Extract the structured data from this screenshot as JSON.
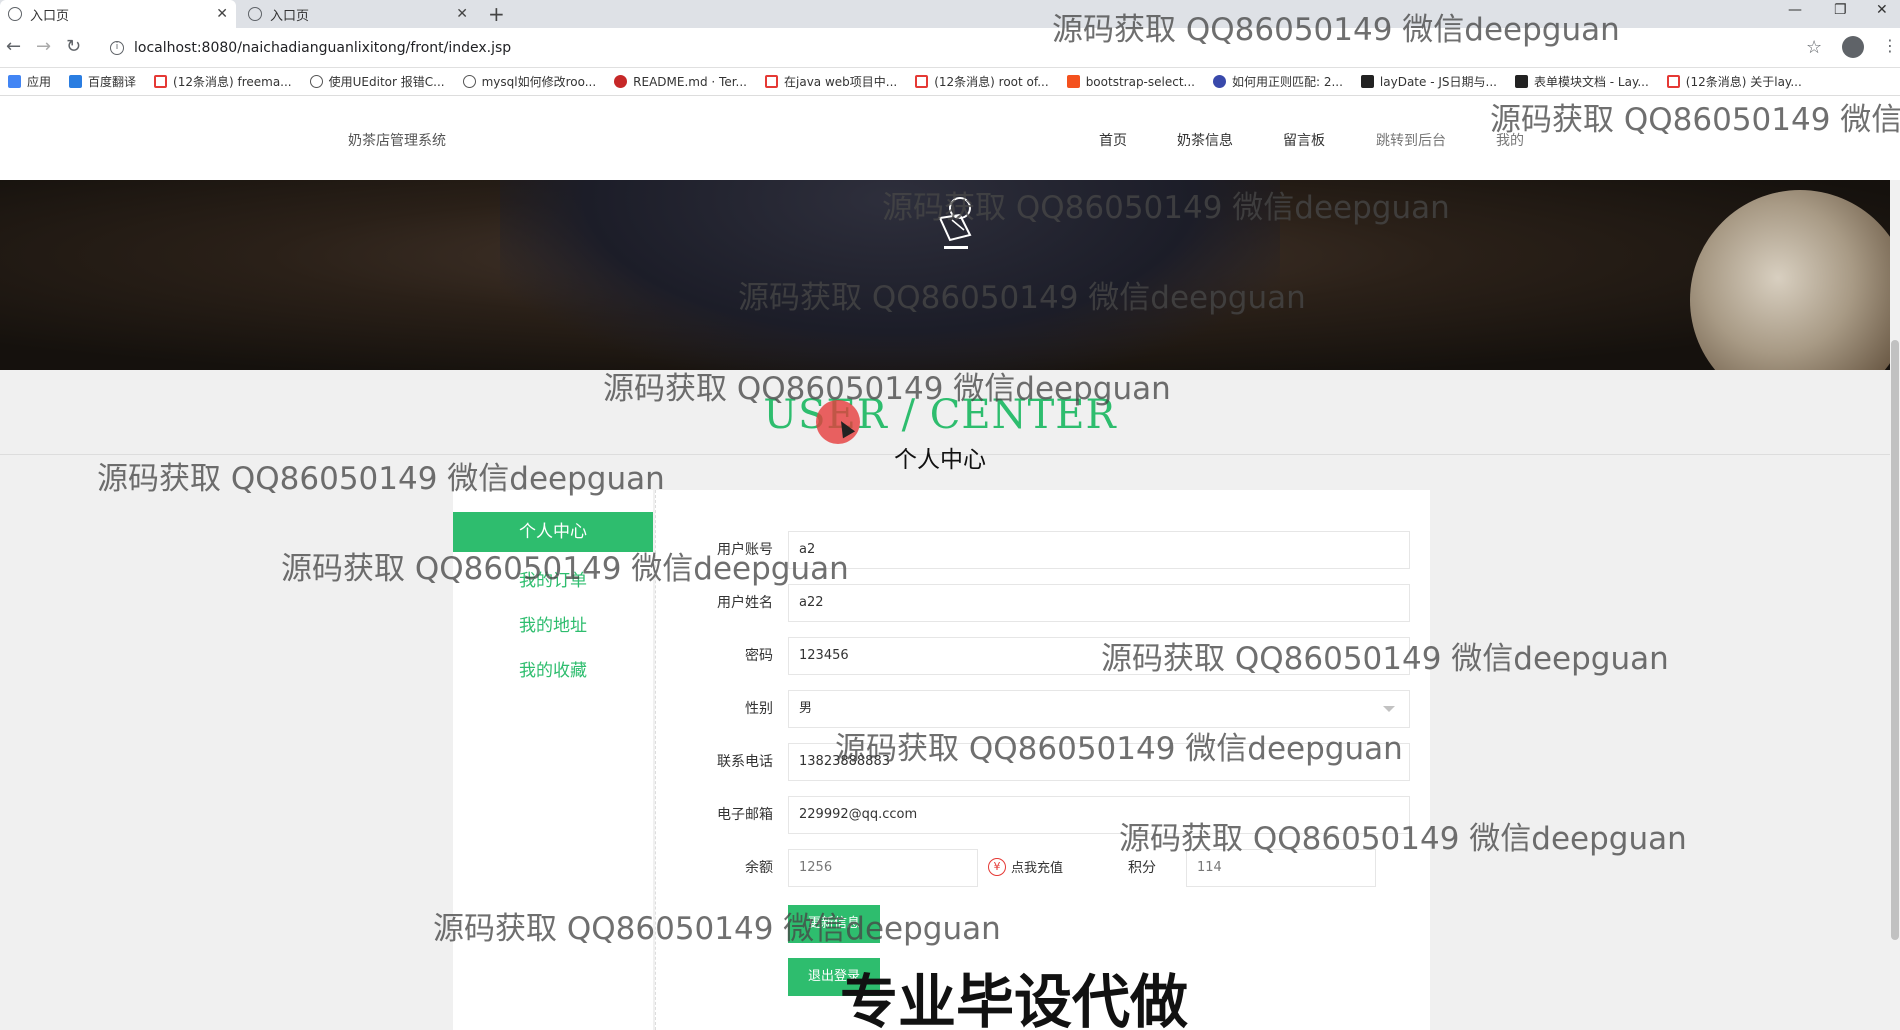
{
  "browser": {
    "tabs": [
      {
        "title": "入口页",
        "active": true
      },
      {
        "title": "入口页",
        "active": false
      }
    ],
    "url": "localhost:8080/naichadianguanlixitong/front/index.jsp",
    "bookmarks": [
      {
        "label": "应用",
        "color": "#4285f4"
      },
      {
        "label": "百度翻译",
        "color": "#2a7de1"
      },
      {
        "label": "(12条消息) freema...",
        "color": "#e53935"
      },
      {
        "label": "使用UEditor 报错C...",
        "color": "#555555"
      },
      {
        "label": "mysql如何修改roo...",
        "color": "#555555"
      },
      {
        "label": "README.md · Ter...",
        "color": "#c62828"
      },
      {
        "label": "在java web项目中...",
        "color": "#e53935"
      },
      {
        "label": "(12条消息) root of...",
        "color": "#e53935"
      },
      {
        "label": "bootstrap-select...",
        "color": "#f4511e"
      },
      {
        "label": "如何用正则匹配: 2...",
        "color": "#3949ab"
      },
      {
        "label": "layDate - JS日期与...",
        "color": "#222222"
      },
      {
        "label": "表单模块文档 - Lay...",
        "color": "#222222"
      },
      {
        "label": "(12条消息) 关于lay...",
        "color": "#e53935"
      }
    ]
  },
  "site": {
    "name": "奶茶店管理系统",
    "nav": [
      "首页",
      "奶茶信息",
      "留言板",
      "跳转到后台",
      "我的"
    ]
  },
  "center": {
    "en_title": "USER / CENTER",
    "cn_title": "个人中心"
  },
  "menu": {
    "active": "个人中心",
    "items": [
      "我的订单",
      "我的地址",
      "我的收藏"
    ]
  },
  "form": {
    "account_label": "用户账号",
    "account_value": "a2",
    "name_label": "用户姓名",
    "name_value": "a22",
    "password_label": "密码",
    "password_value": "123456",
    "gender_label": "性别",
    "gender_value": "男",
    "phone_label": "联系电话",
    "phone_value": "13823888883",
    "email_label": "电子邮箱",
    "email_value": "229992@qq.ccom",
    "balance_label": "余额",
    "balance_value": "1256",
    "recharge_label": "点我充值",
    "points_label": "积分",
    "points_value": "114",
    "update_button": "更新信息",
    "logout_button": "退出登录"
  },
  "watermark": "源码获取 QQ86050149 微信deepguan",
  "overlay_text": "专业毕设代做",
  "colors": {
    "accent": "#2ebd6e"
  }
}
